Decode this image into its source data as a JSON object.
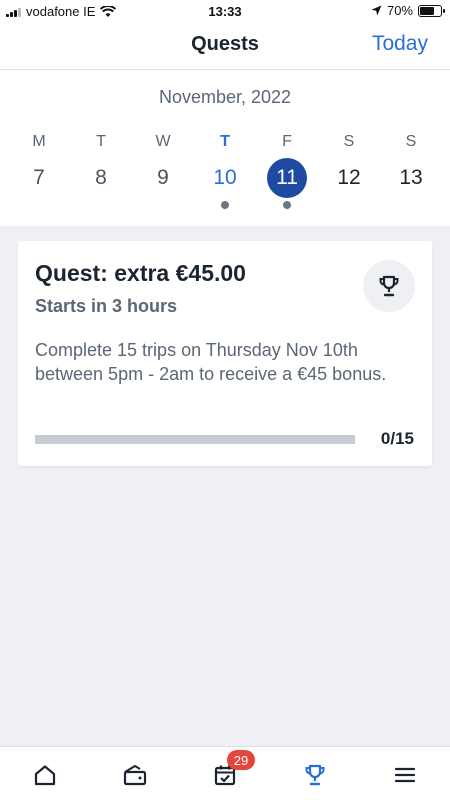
{
  "status_bar": {
    "carrier": "vodafone IE",
    "time": "13:33",
    "battery_percent": "70%",
    "battery_level": 0.7
  },
  "header": {
    "title": "Quests",
    "today_label": "Today"
  },
  "calendar": {
    "month": "November, 2022",
    "days": [
      {
        "dow": "M",
        "num": "7"
      },
      {
        "dow": "T",
        "num": "8"
      },
      {
        "dow": "W",
        "num": "9"
      },
      {
        "dow": "T",
        "num": "10",
        "today": true,
        "has_quest": true
      },
      {
        "dow": "F",
        "num": "11",
        "selected": true,
        "has_quest": true
      },
      {
        "dow": "S",
        "num": "12"
      },
      {
        "dow": "S",
        "num": "13"
      }
    ]
  },
  "quest": {
    "title": "Quest: extra €45.00",
    "starts": "Starts in 3 hours",
    "description": "Complete 15 trips on Thursday Nov 10th between 5pm - 2am to receive a €45 bonus.",
    "progress_label": "0/15",
    "progress_fraction": 0
  },
  "nav": {
    "badge_count": "29",
    "items": [
      "home-icon",
      "wallet-icon",
      "calendar-check-icon",
      "trophy-icon",
      "menu-icon"
    ]
  },
  "colors": {
    "accent": "#2a6fd6",
    "selected": "#1e4aa0",
    "badge": "#e2473b"
  }
}
